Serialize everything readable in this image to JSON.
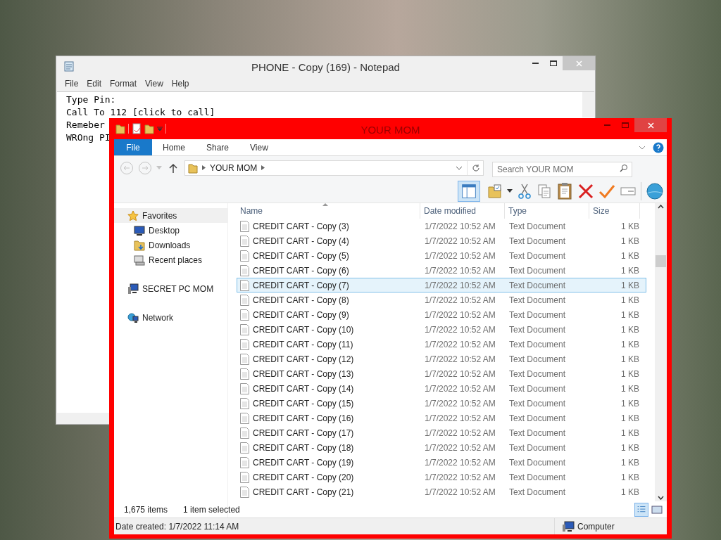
{
  "notepad": {
    "title": "PHONE - Copy (169) - Notepad",
    "menu": [
      "File",
      "Edit",
      "Format",
      "View",
      "Help"
    ],
    "lines": [
      "Type Pin:",
      "Call To 112 [click to call]",
      "Remeber",
      "WROng PI"
    ]
  },
  "explorer": {
    "title": "YOUR MOM",
    "ribbon_tabs": [
      {
        "label": "File",
        "selected": true
      },
      {
        "label": "Home",
        "selected": false
      },
      {
        "label": "Share",
        "selected": false
      },
      {
        "label": "View",
        "selected": false
      }
    ],
    "address": "YOUR MOM",
    "search": {
      "placeholder": "Search YOUR MOM"
    },
    "sidebar": [
      {
        "label": "Favorites",
        "selected": true,
        "children": [
          {
            "label": "Desktop",
            "selected": false
          },
          {
            "label": "Downloads",
            "selected": false
          },
          {
            "label": "Recent places",
            "selected": false
          }
        ]
      },
      {
        "label": "SECRET PC MOM",
        "selected": false
      },
      {
        "label": "Network",
        "selected": false
      }
    ],
    "columns": [
      "Name",
      "Date modified",
      "Type",
      "Size"
    ],
    "rows": [
      {
        "name": "CREDIT CART - Copy (3)",
        "date": "1/7/2022 10:52 AM",
        "type": "Text Document",
        "size": "1 KB",
        "selected": false
      },
      {
        "name": "CREDIT CART - Copy (4)",
        "date": "1/7/2022 10:52 AM",
        "type": "Text Document",
        "size": "1 KB",
        "selected": false
      },
      {
        "name": "CREDIT CART - Copy (5)",
        "date": "1/7/2022 10:52 AM",
        "type": "Text Document",
        "size": "1 KB",
        "selected": false
      },
      {
        "name": "CREDIT CART - Copy (6)",
        "date": "1/7/2022 10:52 AM",
        "type": "Text Document",
        "size": "1 KB",
        "selected": false
      },
      {
        "name": "CREDIT CART - Copy (7)",
        "date": "1/7/2022 10:52 AM",
        "type": "Text Document",
        "size": "1 KB",
        "selected": true
      },
      {
        "name": "CREDIT CART - Copy (8)",
        "date": "1/7/2022 10:52 AM",
        "type": "Text Document",
        "size": "1 KB",
        "selected": false
      },
      {
        "name": "CREDIT CART - Copy (9)",
        "date": "1/7/2022 10:52 AM",
        "type": "Text Document",
        "size": "1 KB",
        "selected": false
      },
      {
        "name": "CREDIT CART - Copy (10)",
        "date": "1/7/2022 10:52 AM",
        "type": "Text Document",
        "size": "1 KB",
        "selected": false
      },
      {
        "name": "CREDIT CART - Copy (11)",
        "date": "1/7/2022 10:52 AM",
        "type": "Text Document",
        "size": "1 KB",
        "selected": false
      },
      {
        "name": "CREDIT CART - Copy (12)",
        "date": "1/7/2022 10:52 AM",
        "type": "Text Document",
        "size": "1 KB",
        "selected": false
      },
      {
        "name": "CREDIT CART - Copy (13)",
        "date": "1/7/2022 10:52 AM",
        "type": "Text Document",
        "size": "1 KB",
        "selected": false
      },
      {
        "name": "CREDIT CART - Copy (14)",
        "date": "1/7/2022 10:52 AM",
        "type": "Text Document",
        "size": "1 KB",
        "selected": false
      },
      {
        "name": "CREDIT CART - Copy (15)",
        "date": "1/7/2022 10:52 AM",
        "type": "Text Document",
        "size": "1 KB",
        "selected": false
      },
      {
        "name": "CREDIT CART - Copy (16)",
        "date": "1/7/2022 10:52 AM",
        "type": "Text Document",
        "size": "1 KB",
        "selected": false
      },
      {
        "name": "CREDIT CART - Copy (17)",
        "date": "1/7/2022 10:52 AM",
        "type": "Text Document",
        "size": "1 KB",
        "selected": false
      },
      {
        "name": "CREDIT CART - Copy (18)",
        "date": "1/7/2022 10:52 AM",
        "type": "Text Document",
        "size": "1 KB",
        "selected": false
      },
      {
        "name": "CREDIT CART - Copy (19)",
        "date": "1/7/2022 10:52 AM",
        "type": "Text Document",
        "size": "1 KB",
        "selected": false
      },
      {
        "name": "CREDIT CART - Copy (20)",
        "date": "1/7/2022 10:52 AM",
        "type": "Text Document",
        "size": "1 KB",
        "selected": false
      },
      {
        "name": "CREDIT CART - Copy (21)",
        "date": "1/7/2022 10:52 AM",
        "type": "Text Document",
        "size": "1 KB",
        "selected": false
      }
    ],
    "item_count": "1,675 items",
    "selection_count": "1 item selected",
    "details": "Date created: 1/7/2022 11:14 AM",
    "location": "Computer"
  }
}
